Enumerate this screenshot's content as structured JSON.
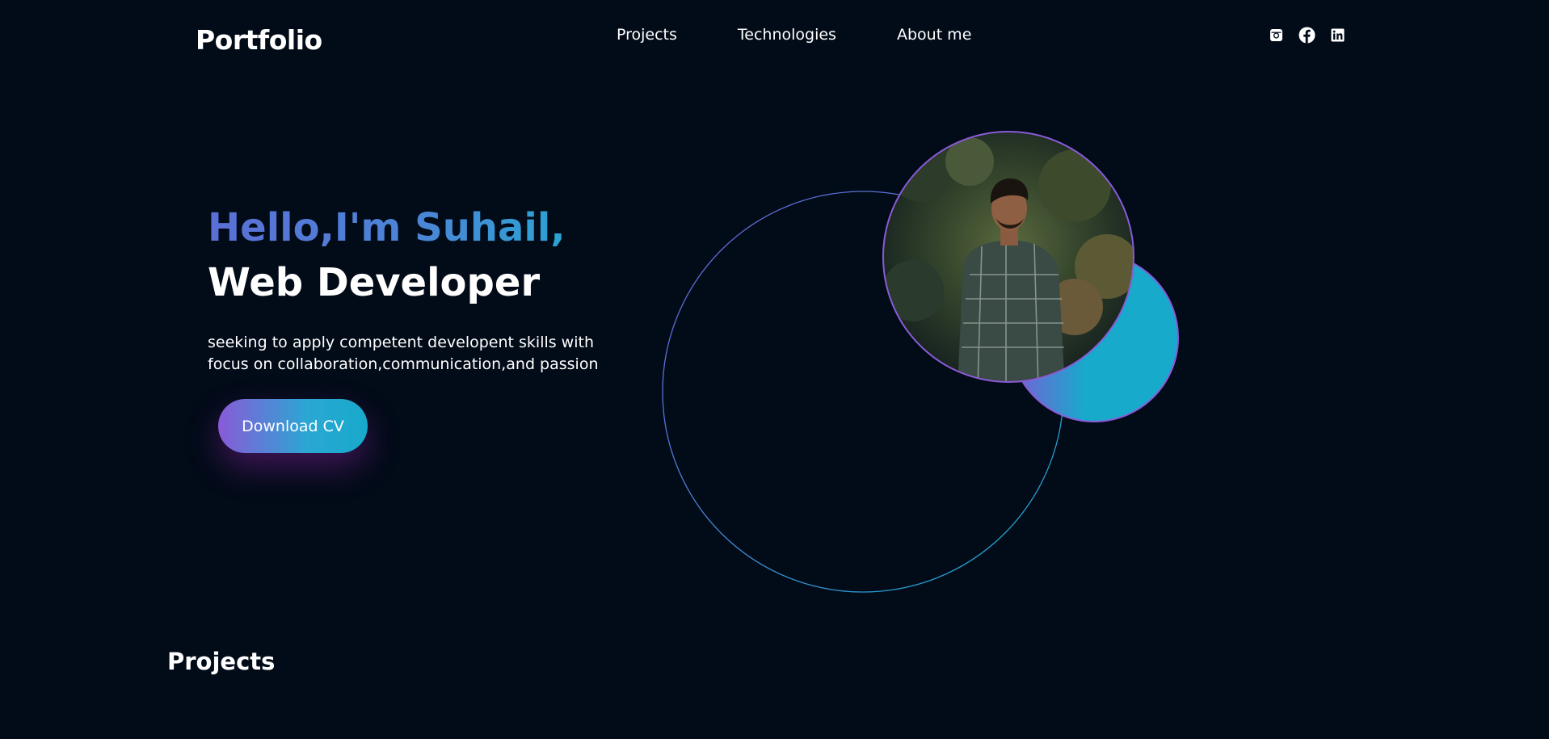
{
  "header": {
    "logo": "Portfolio",
    "nav": [
      "Projects",
      "Technologies",
      "About me"
    ],
    "social_icons": [
      "instagram-icon",
      "facebook-icon",
      "linkedin-icon"
    ]
  },
  "hero": {
    "greeting": "Hello,I'm Suhail,",
    "role": "Web Developer",
    "description_lines": [
      "seeking to apply competent developent skills with",
      "focus on collaboration,communication,and passion"
    ],
    "cta_label": "Download CV"
  },
  "sections": {
    "projects_title": "Projects"
  },
  "colors": {
    "background": "#020b18",
    "accent_purple": "#8a5ad8",
    "accent_cyan": "#17aacb",
    "greeting_blue": "#4a86d6"
  }
}
